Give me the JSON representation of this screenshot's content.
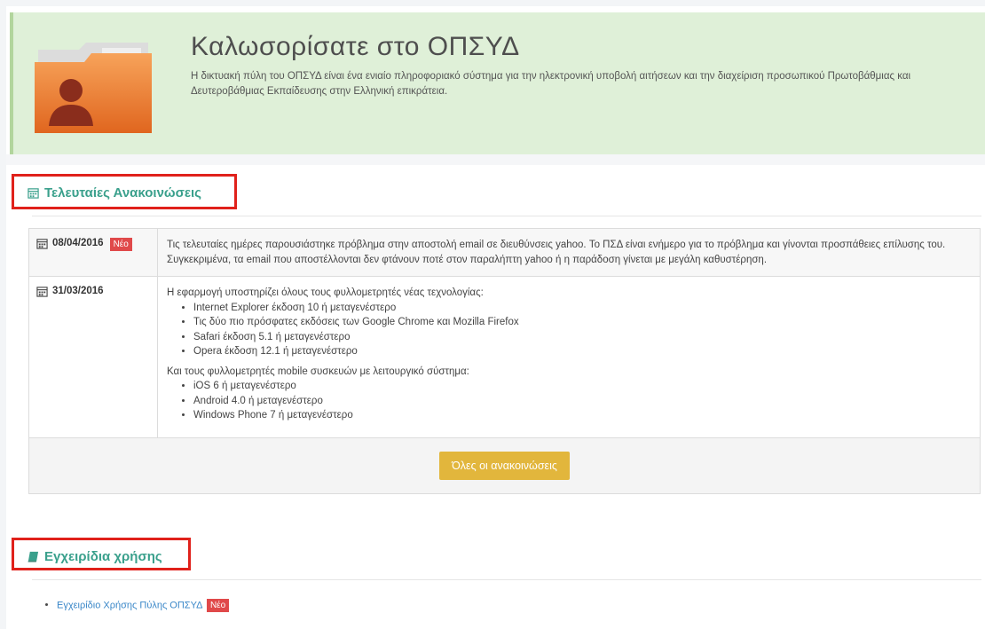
{
  "banner": {
    "title": "Καλωσορίσατε στο ΟΠΣΥΔ",
    "description": "Η δικτυακή πύλη του ΟΠΣΥΔ είναι ένα ενιαίο πληροφοριακό σύστημα για την ηλεκτρονική υποβολή αιτήσεων και την διαχείριση προσωπικού Πρωτοβάθμιας και Δευτεροβάθμιας Εκπαίδευσης στην Ελληνική επικράτεια."
  },
  "announcements": {
    "heading": "Τελευταίες Ανακοινώσεις",
    "items": [
      {
        "date": "08/04/2016",
        "badge": "Νέο",
        "text": "Τις τελευταίες ημέρες παρουσιάστηκε πρόβλημα στην αποστολή email σε διευθύνσεις yahoo. Το ΠΣΔ είναι ενήμερο για το πρόβλημα και γίνονται προσπάθειες επίλυσης του. Συγκεκριμένα, τα email που αποστέλλονται δεν φτάνουν ποτέ στον παραλήπτη yahoo ή η παράδοση γίνεται με μεγάλη καθυστέρηση."
      },
      {
        "date": "31/03/2016",
        "intro": "Η εφαρμογή υποστηρίζει όλους τους φυλλομετρητές νέας τεχνολογίας:",
        "desktop": [
          "Internet Explorer έκδοση 10 ή μεταγενέστερο",
          "Τις δύο πιο πρόσφατες εκδόσεις των Google Chrome και Mozilla Firefox",
          "Safari έκδοση 5.1 ή μεταγενέστερο",
          "Opera έκδοση 12.1 ή μεταγενέστερο"
        ],
        "mobile_intro": "Και τους φυλλομετρητές mobile συσκευών με λειτουργικό σύστημα:",
        "mobile": [
          "iOS 6 ή μεταγενέστερο",
          "Android 4.0 ή μεταγενέστερο",
          "Windows Phone 7 ή μεταγενέστερο"
        ]
      }
    ],
    "all_button": "Όλες οι ανακοινώσεις"
  },
  "manuals": {
    "heading": "Εγχειρίδια χρήσης",
    "items": [
      {
        "label": "Εγχειρίδιο Χρήσης Πύλης ΟΠΣΥΔ",
        "badge": "Νέο"
      }
    ]
  },
  "colors": {
    "accent": "#3aa08c",
    "banner_bg": "#dff0d8",
    "badge": "#e0494a",
    "button": "#e2b63c",
    "highlight_box": "#e0211b"
  }
}
